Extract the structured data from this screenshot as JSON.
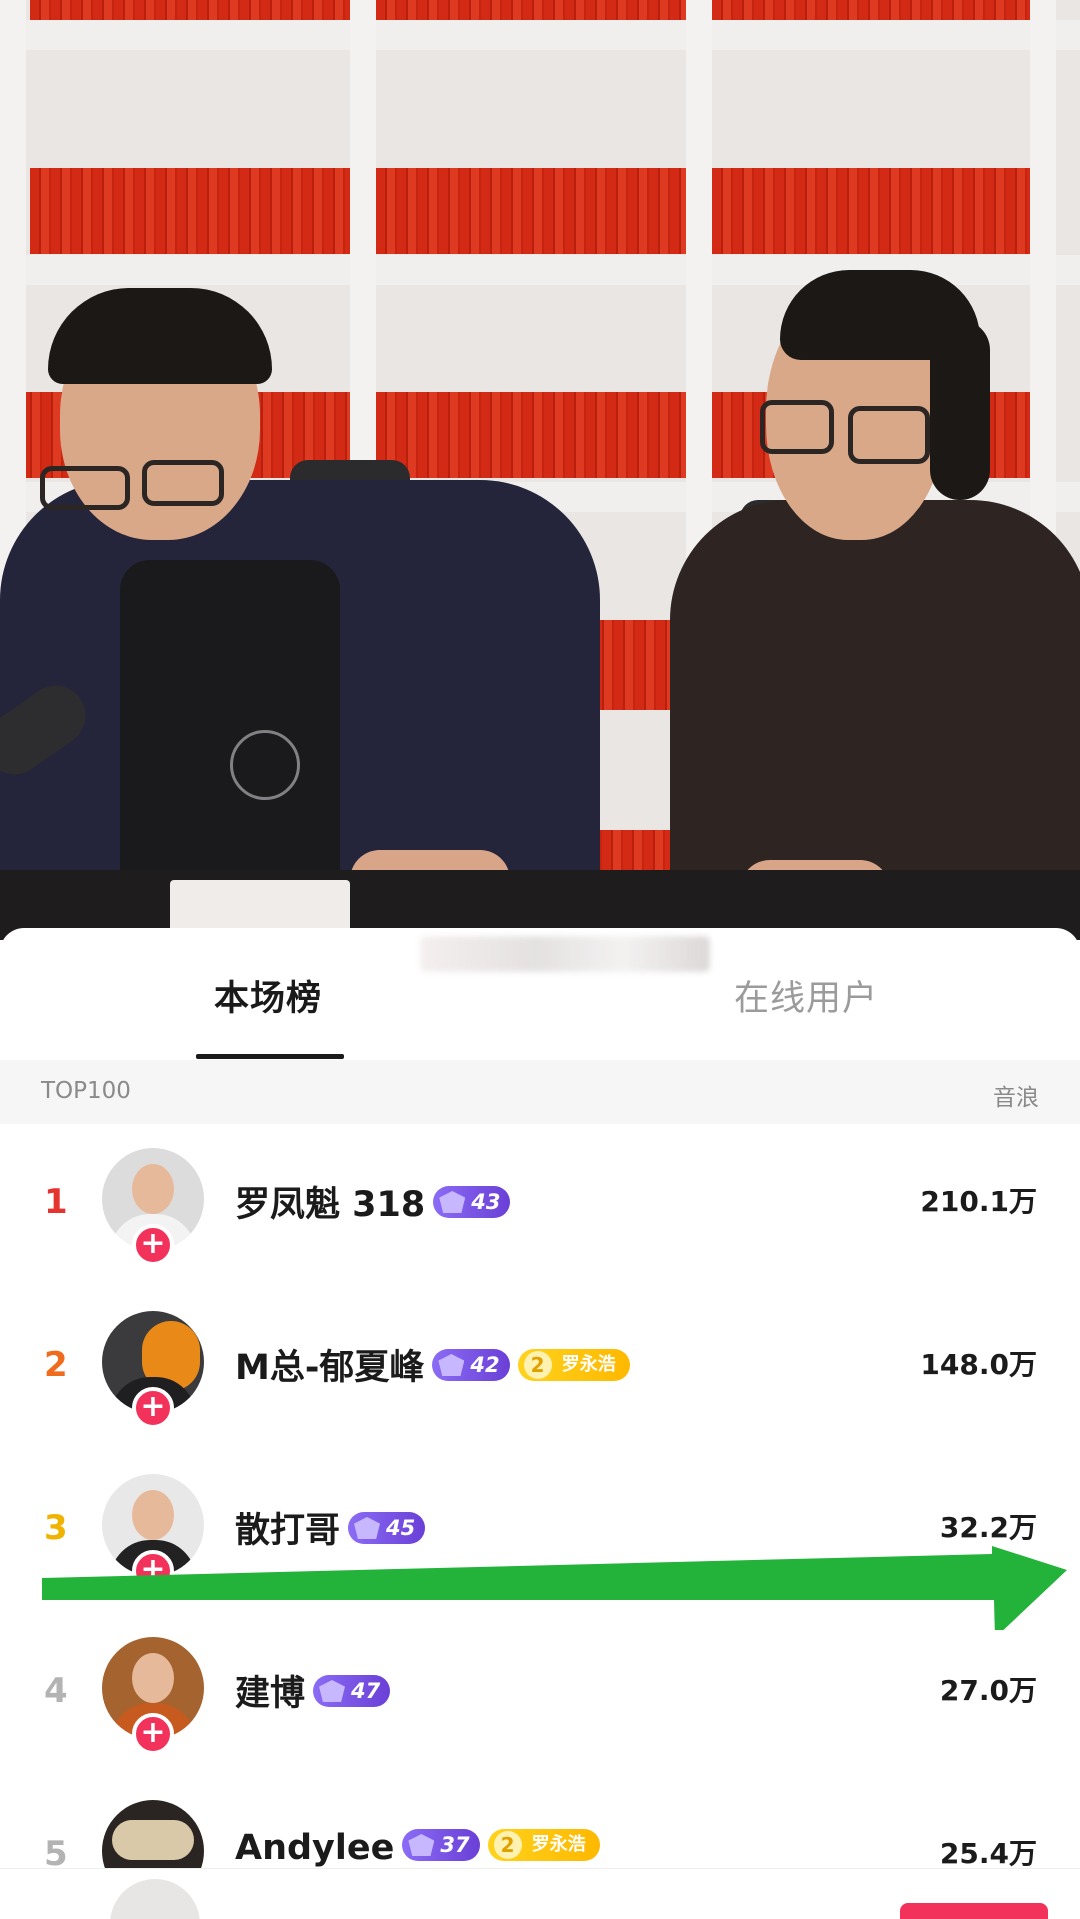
{
  "tabs": [
    {
      "label": "本场榜",
      "active": true
    },
    {
      "label": "在线用户",
      "active": false
    }
  ],
  "list_header": {
    "left": "TOP100",
    "right": "音浪"
  },
  "follow_symbol": "+",
  "colors": {
    "rank_1": "#e5342f",
    "rank_2": "#ef6c1e",
    "rank_3": "#f0b400",
    "rank_other": "#b3b3b3",
    "follow": "#f2325a",
    "arrow": "#23b23a"
  },
  "leaderboard": [
    {
      "rank": "1",
      "name": "罗凤魁 318",
      "level": "43",
      "fan_badge": null,
      "score": "210.1万"
    },
    {
      "rank": "2",
      "name": "M总-郁夏峰",
      "level": "42",
      "fan_badge": {
        "num": "2",
        "label": "罗永浩"
      },
      "score": "148.0万"
    },
    {
      "rank": "3",
      "name": "散打哥",
      "level": "45",
      "fan_badge": null,
      "score": "32.2万"
    },
    {
      "rank": "4",
      "name": "建博",
      "level": "47",
      "fan_badge": null,
      "score": "27.0万"
    },
    {
      "rank": "5",
      "name": "Andylee",
      "level": "37",
      "fan_badge": {
        "num": "2",
        "label": "罗永浩"
      },
      "score": "25.4万"
    }
  ]
}
